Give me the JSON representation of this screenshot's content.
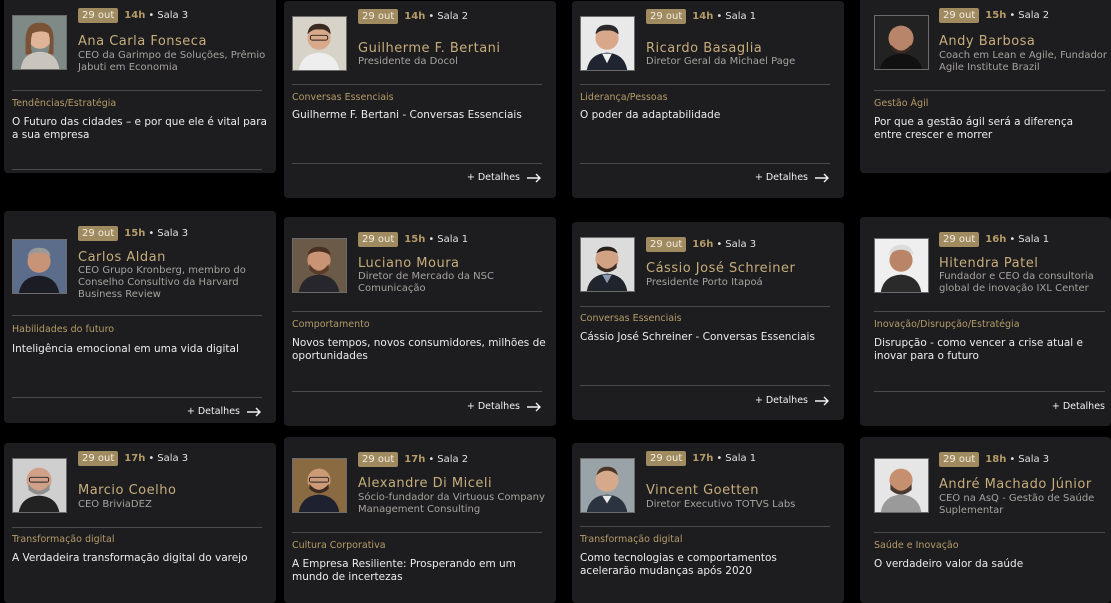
{
  "details_label": "+ Detalhes",
  "cards": [
    {
      "date": "29 out",
      "time": "14h",
      "room": "Sala 3",
      "name": "Ana Carla Fonseca",
      "role": "CEO da Garimpo de Soluções, Prêmio Jabuti em Economia",
      "tag": "Tendências/Estratégia",
      "topic": "O Futuro das cidades – e por que ele é vital para a sua empresa"
    },
    {
      "date": "29 out",
      "time": "14h",
      "room": "Sala 2",
      "name": "Guilherme F. Bertani",
      "role": "Presidente da Docol",
      "tag": "Conversas Essenciais",
      "topic": "Guilherme F. Bertani - Conversas Essenciais"
    },
    {
      "date": "29 out",
      "time": "14h",
      "room": "Sala 1",
      "name": "Ricardo Basaglia",
      "role": "Diretor Geral da Michael Page",
      "tag": "Liderança/Pessoas",
      "topic": "O poder da adaptabilidade"
    },
    {
      "date": "29 out",
      "time": "15h",
      "room": "Sala 2",
      "name": "Andy Barbosa",
      "role": "Coach em Lean e Agile, Fundador Agile Institute Brazil",
      "tag": "Gestão Ágil",
      "topic": "Por que a gestão ágil será a diferença entre crescer e morrer"
    },
    {
      "date": "29 out",
      "time": "15h",
      "room": "Sala 3",
      "name": "Carlos Aldan",
      "role": "CEO Grupo Kronberg, membro do Conselho Consultivo da Harvard Business Review",
      "tag": "Habilidades do futuro",
      "topic": "Inteligência emocional em uma vida digital"
    },
    {
      "date": "29 out",
      "time": "15h",
      "room": "Sala 1",
      "name": "Luciano Moura",
      "role": "Diretor de Mercado da NSC Comunicação",
      "tag": "Comportamento",
      "topic": "Novos tempos, novos consumidores, milhões de oportunidades"
    },
    {
      "date": "29 out",
      "time": "16h",
      "room": "Sala 3",
      "name": "Cássio José Schreiner",
      "role": "Presidente Porto Itapoá",
      "tag": "Conversas Essenciais",
      "topic": "Cássio José Schreiner - Conversas Essenciais"
    },
    {
      "date": "29 out",
      "time": "16h",
      "room": "Sala 1",
      "name": "Hitendra Patel",
      "role": "Fundador e CEO da consultoria global de inovação IXL Center",
      "tag": "Inovação/Disrupção/Estratégia",
      "topic": "Disrupção - como vencer a crise atual e inovar para o futuro"
    },
    {
      "date": "29 out",
      "time": "17h",
      "room": "Sala 3",
      "name": "Marcio Coelho",
      "role": "CEO BriviaDEZ",
      "tag": "Transformação digital",
      "topic": "A Verdadeira transformação digital do varejo"
    },
    {
      "date": "29 out",
      "time": "17h",
      "room": "Sala 2",
      "name": "Alexandre Di Miceli",
      "role": "Sócio-fundador da Virtuous Company Management Consulting",
      "tag": "Cultura Corporativa",
      "topic": "A Empresa Resiliente: Prosperando em um mundo de incertezas"
    },
    {
      "date": "29 out",
      "time": "17h",
      "room": "Sala 1",
      "name": "Vincent Goetten",
      "role": "Diretor Executivo TOTVS Labs",
      "tag": "Transformação digital",
      "topic": "Como tecnologias e comportamentos acelerarão mudanças após 2020"
    },
    {
      "date": "29 out",
      "time": "18h",
      "room": "Sala 3",
      "name": "André Machado Júnior",
      "role": "CEO na AsQ - Gestão de Saúde Suplementar",
      "tag": "Saúde e Inovação",
      "topic": "O verdadeiro valor da saúde"
    }
  ]
}
